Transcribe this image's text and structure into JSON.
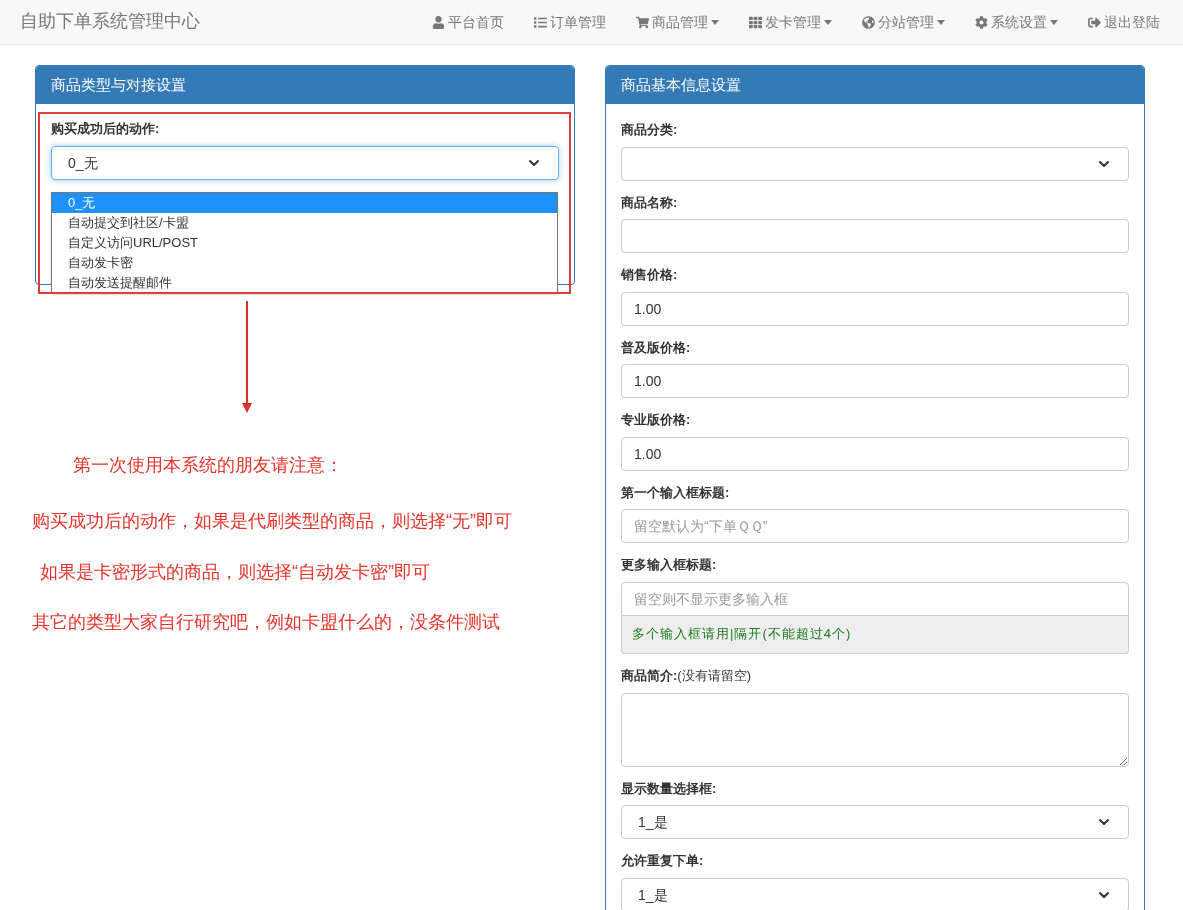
{
  "navbar": {
    "brand": "自助下单系统管理中心",
    "items": [
      {
        "label": "平台首页",
        "dropdown": false
      },
      {
        "label": "订单管理",
        "dropdown": false
      },
      {
        "label": "商品管理",
        "dropdown": true
      },
      {
        "label": "发卡管理",
        "dropdown": true
      },
      {
        "label": "分站管理",
        "dropdown": true
      },
      {
        "label": "系统设置",
        "dropdown": true
      },
      {
        "label": "退出登陆",
        "dropdown": false
      }
    ]
  },
  "left_panel": {
    "title": "商品类型与对接设置",
    "field": {
      "label": "购买成功后的动作:",
      "value": "0_无",
      "options": [
        {
          "label": "0_无",
          "selected": true
        },
        {
          "label": "自动提交到社区/卡盟",
          "selected": false
        },
        {
          "label": "自定义访问URL/POST",
          "selected": false
        },
        {
          "label": "自动发卡密",
          "selected": false
        },
        {
          "label": "自动发送提醒邮件",
          "selected": false
        }
      ]
    }
  },
  "annotation": {
    "lines": [
      {
        "text": "第一次使用本系统的朋友请注意："
      },
      {
        "text": "购买成功后的动作，如果是代刷类型的商品，则选择“无”即可"
      },
      {
        "text": "如果是卡密形式的商品，则选择“自动发卡密”即可"
      },
      {
        "text": "其它的类型大家自行研究吧，例如卡盟什么的，没条件测试"
      }
    ]
  },
  "right_panel": {
    "title": "商品基本信息设置",
    "fields": [
      {
        "label": "商品分类:",
        "kind": "select"
      },
      {
        "label": "商品名称:",
        "kind": "input"
      },
      {
        "label": "销售价格:",
        "kind": "input",
        "value": "1.00"
      },
      {
        "label": "普及版价格:",
        "kind": "input",
        "value": "1.00"
      },
      {
        "label": "专业版价格:",
        "kind": "input",
        "value": "1.00"
      },
      {
        "label": "第一个输入框标题:",
        "kind": "input",
        "placeholder": "留空默认为“下单ＱＱ”"
      },
      {
        "label": "更多输入框标题:",
        "kind": "input",
        "placeholder": "留空则不显示更多输入框",
        "help": "多个输入框请用|隔开(不能超过4个)"
      },
      {
        "label": "商品简介:",
        "note": "(没有请留空)",
        "kind": "textarea"
      },
      {
        "label": "显示数量选择框:",
        "kind": "select",
        "value": "1_是"
      },
      {
        "label": "允许重复下单:",
        "kind": "select",
        "value": "1_是"
      }
    ]
  }
}
